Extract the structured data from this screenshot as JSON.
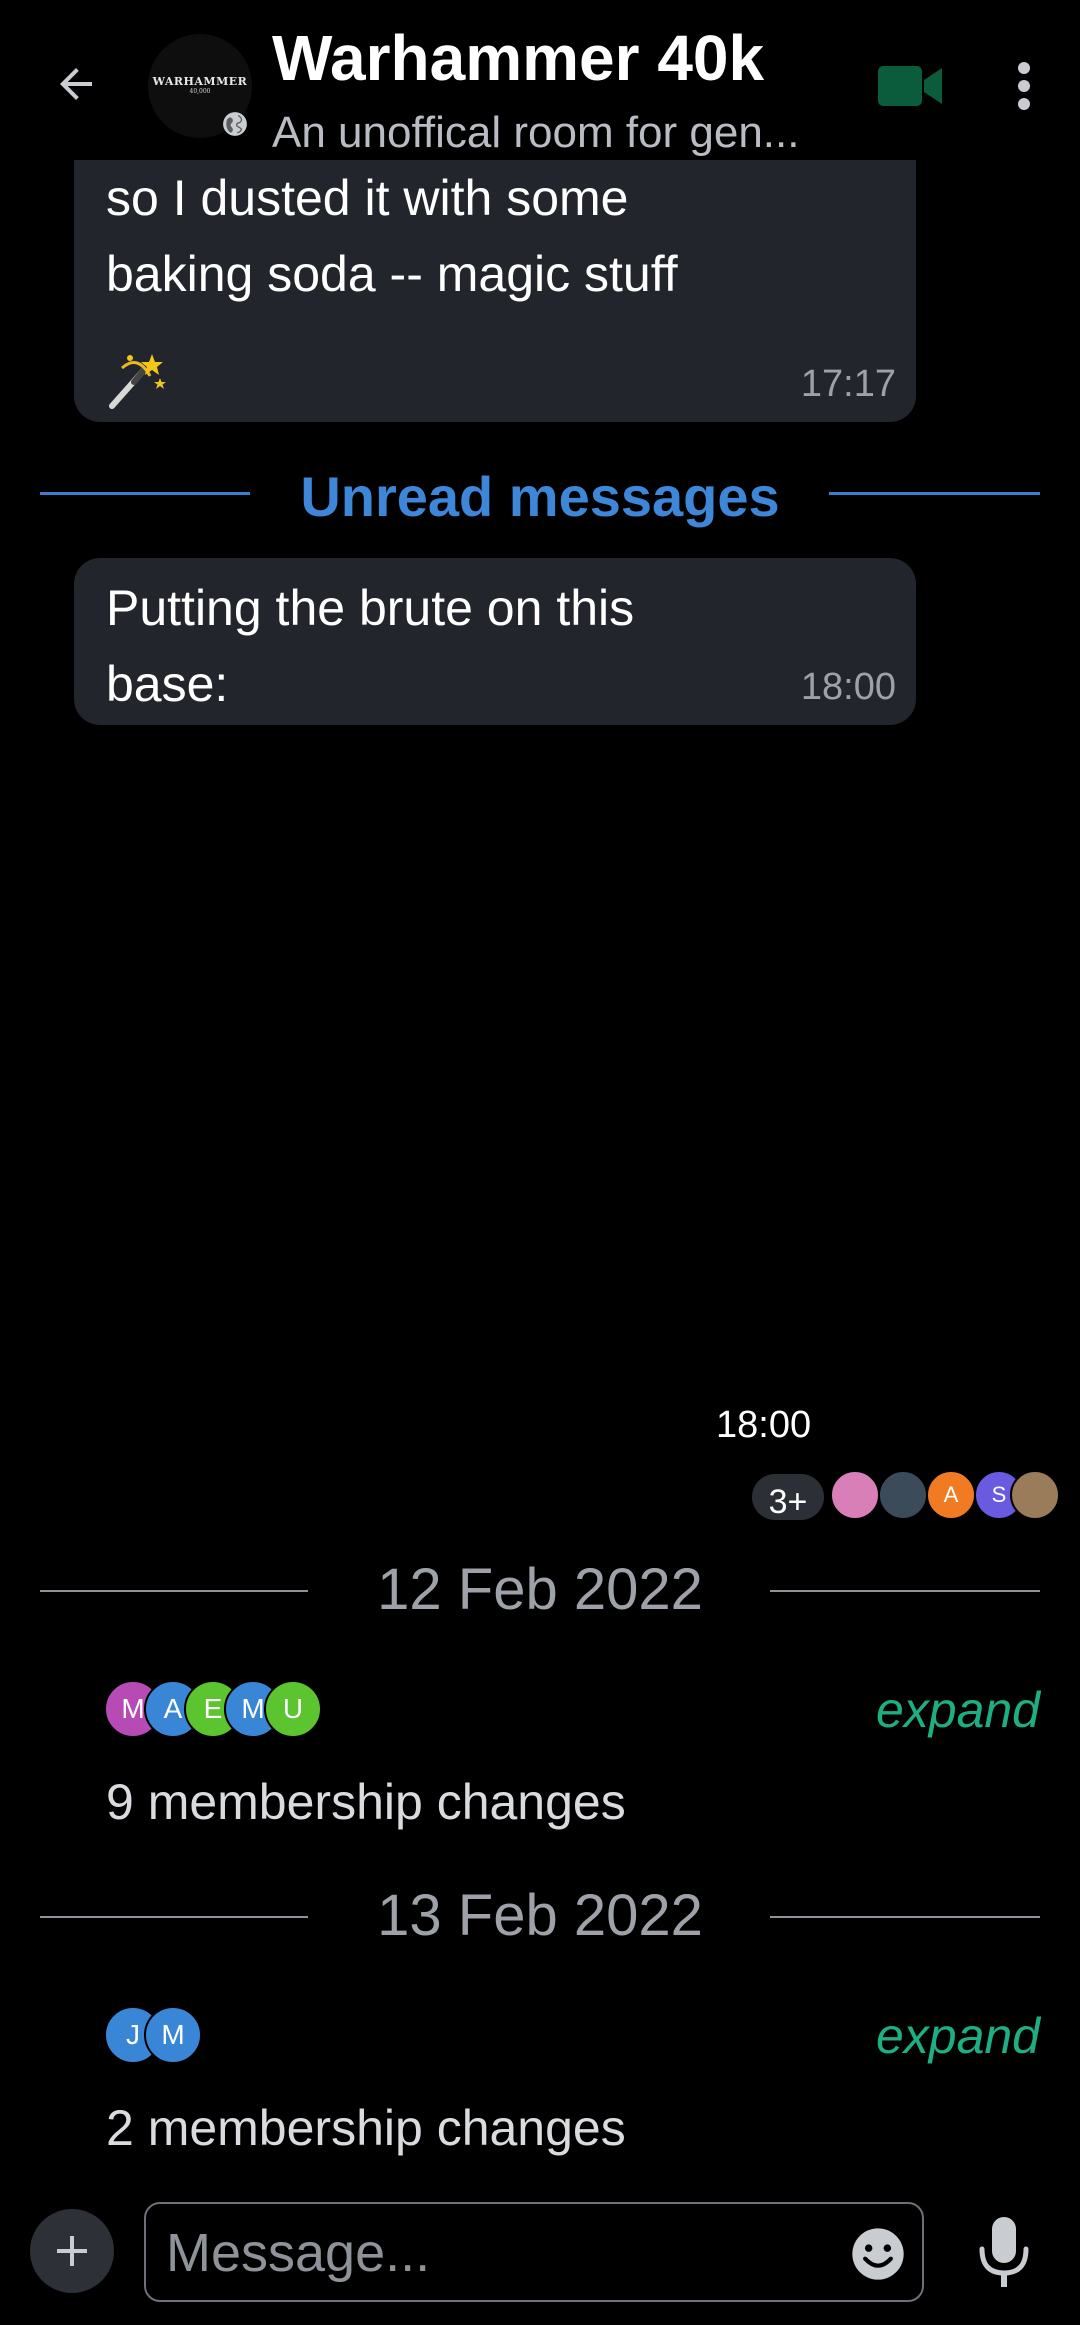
{
  "header": {
    "title": "Warhammer 40k",
    "topic": "An unoffical room for gen...",
    "avatar_logo_top": "WARHAMMER",
    "avatar_logo_bottom": "40,000",
    "video_icon_color": "#0a5c3c"
  },
  "messages": [
    {
      "text": "for some unknown reason,\nso I dusted it with some\nbaking soda -- magic stuff",
      "emoji": "magic-wand",
      "time": "17:17"
    },
    {
      "text": "Putting the brute on this\nbase:",
      "time": "18:00"
    }
  ],
  "unread_separator": "Unread messages",
  "standalone_time": "18:00",
  "read_receipts": {
    "count_label": "3+",
    "avatars": [
      {
        "letter": "",
        "color": "#d77fb6"
      },
      {
        "letter": "",
        "color": "#3c4b5a"
      },
      {
        "letter": "A",
        "color": "#f07b22"
      },
      {
        "letter": "S",
        "color": "#6a5ae0"
      },
      {
        "letter": "",
        "color": "#9a7b5a"
      }
    ]
  },
  "day_groups": [
    {
      "date": "12 Feb 2022",
      "avatars": [
        {
          "letter": "M",
          "color": "#b64bb6"
        },
        {
          "letter": "A",
          "color": "#3a86d6"
        },
        {
          "letter": "E",
          "color": "#5cc42e"
        },
        {
          "letter": "M",
          "color": "#3a86d6"
        },
        {
          "letter": "U",
          "color": "#5cc42e"
        }
      ],
      "expand_label": "expand",
      "summary": "9 membership changes"
    },
    {
      "date": "13 Feb 2022",
      "avatars": [
        {
          "letter": "J",
          "color": "#3a86d6"
        },
        {
          "letter": "M",
          "color": "#3a86d6"
        }
      ],
      "expand_label": "expand",
      "summary": "2 membership changes"
    }
  ],
  "composer": {
    "placeholder": "Message..."
  },
  "colors": {
    "accent_blue": "#3d86d8",
    "expand_green": "#1dae84",
    "bubble_bg": "#22252b"
  }
}
